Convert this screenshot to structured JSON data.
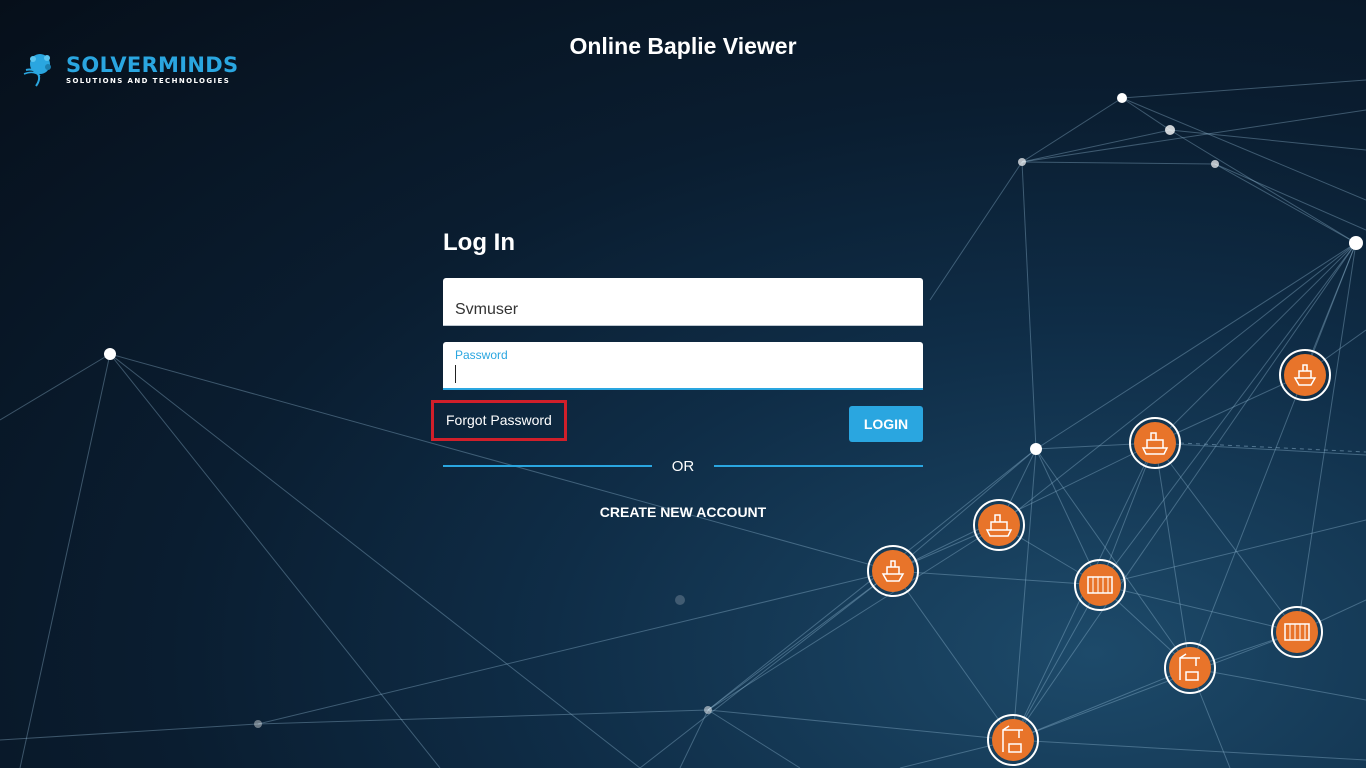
{
  "header": {
    "logo": {
      "name": "SOLVERMINDS",
      "tagline": "SOLUTIONS AND TECHNOLOGIES",
      "icon": "brain-bulb-logo-icon",
      "color": "#2aa6e0"
    },
    "app_title": "Online Baplie Viewer"
  },
  "login": {
    "heading": "Log In",
    "username": {
      "value": "Svmuser",
      "placeholder": ""
    },
    "password": {
      "label": "Password",
      "value": ""
    },
    "forgot_password": "Forgot Password",
    "login_button": "LOGIN",
    "divider_text": "OR",
    "create_account": "CREATE NEW ACCOUNT"
  },
  "background": {
    "theme": "network-nodes",
    "node_icons": [
      "ship-icon",
      "ship-icon",
      "ship-icon",
      "port-ship-icon",
      "container-icon",
      "container-icon",
      "crane-icon",
      "crane-icon"
    ]
  },
  "colors": {
    "accent": "#2aa6e0",
    "node_orange": "#e8742a",
    "highlight_border": "#d01f2a",
    "background_dark": "#0a1d30"
  }
}
